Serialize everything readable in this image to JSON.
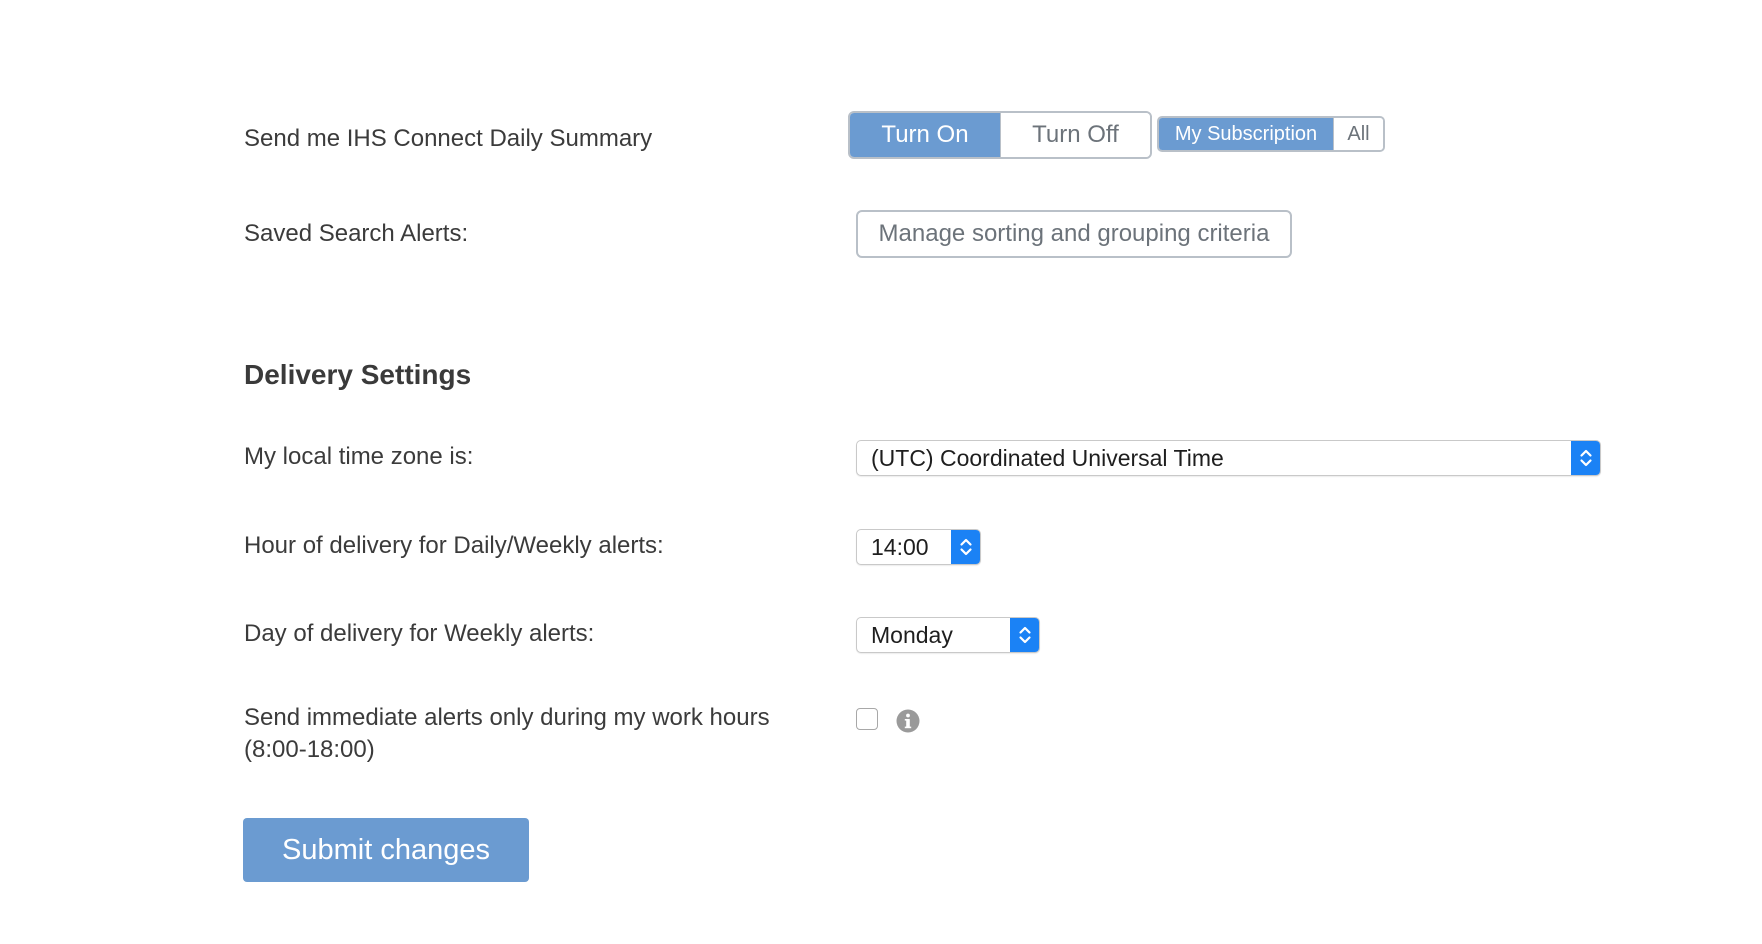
{
  "daily_summary": {
    "label": "Send me IHS Connect Daily Summary",
    "turn_on_label": "Turn On",
    "turn_off_label": "Turn Off",
    "selected": "Turn On",
    "scope_mine_label": "My Subscription",
    "scope_all_label": "All",
    "scope_selected": "My Subscription"
  },
  "saved_search": {
    "label": "Saved Search Alerts:",
    "manage_button_label": "Manage sorting and grouping criteria"
  },
  "delivery": {
    "heading": "Delivery Settings",
    "timezone_label": "My local time zone is:",
    "timezone_value": "(UTC) Coordinated Universal Time",
    "hour_label": "Hour of delivery for Daily/Weekly alerts:",
    "hour_value": "14:00",
    "day_label": "Day of delivery for Weekly alerts:",
    "day_value": "Monday",
    "work_hours_label_line1": "Send immediate alerts only during my work hours",
    "work_hours_label_line2": "(8:00-18:00)",
    "work_hours_checked": false
  },
  "submit_label": "Submit changes",
  "icons": {
    "select_arrows": "updown-chevron-icon",
    "info": "info-icon"
  },
  "colors": {
    "accent": "#6b9bd1",
    "select_arrow": "#1b82f5",
    "border": "#b9c0c8",
    "text": "#3b3b3b",
    "muted_text": "#6c737a"
  }
}
